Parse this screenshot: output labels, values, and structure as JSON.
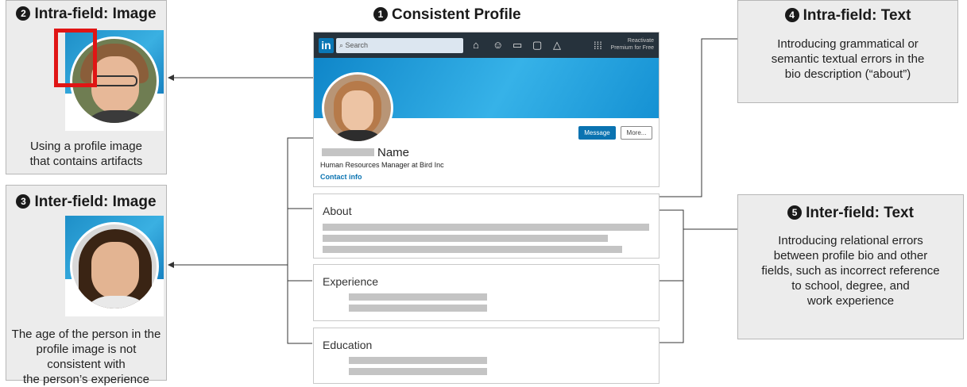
{
  "header_title": "Consistent Profile",
  "header_num": "1",
  "panels": {
    "intra_image": {
      "num": "2",
      "title": "Intra-field: Image",
      "text": "Using a profile image\nthat contains artifacts"
    },
    "inter_image": {
      "num": "3",
      "title": "Inter-field: Image",
      "text": "The age of the person in the\nprofile image is not consistent with\nthe person’s experience"
    },
    "intra_text": {
      "num": "4",
      "title": "Intra-field: Text",
      "text": "Introducing grammatical or\nsemantic textual errors in the\nbio description (“about”)"
    },
    "inter_text": {
      "num": "5",
      "title": "Inter-field: Text",
      "text": "Introducing relational errors\nbetween profile bio and other\nfields, such as incorrect reference\nto school, degree, and\nwork experience"
    }
  },
  "profile": {
    "logo": "in",
    "search_placeholder": "Search",
    "premium": "Reactivate\nPremium for Free",
    "nav_icons": [
      "home-icon",
      "people-icon",
      "briefcase-icon",
      "messaging-icon",
      "bell-icon"
    ],
    "message_button": "Message",
    "more_button": "More...",
    "name": "Name",
    "headline": "Human Resources Manager at Bird Inc",
    "contact": "Contact info"
  },
  "sections": [
    "About",
    "Experience",
    "Education"
  ],
  "colors": {
    "linkedin_blue": "#0a77b5",
    "navbar": "#26323c",
    "artifact_box": "#e01515",
    "panel_bg": "#ececec"
  }
}
